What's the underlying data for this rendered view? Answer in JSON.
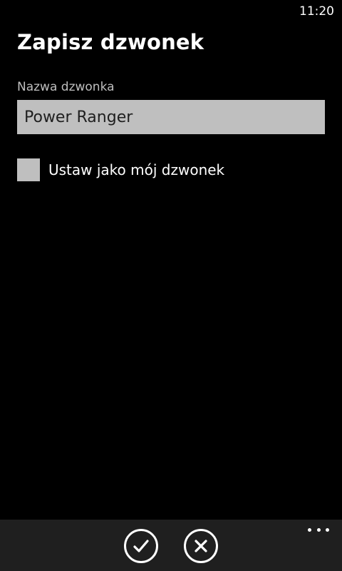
{
  "status_bar": {
    "time": "11:20"
  },
  "page": {
    "title": "Zapisz dzwonek"
  },
  "form": {
    "name_label": "Nazwa dzwonka",
    "name_value": "Power Ranger",
    "set_as_ringtone_label": "Ustaw jako mój dzwonek",
    "set_as_ringtone_checked": false
  },
  "app_bar": {
    "buttons": [
      {
        "icon": "check-icon"
      },
      {
        "icon": "close-icon"
      }
    ],
    "more_icon": "more-options-icon"
  },
  "colors": {
    "background": "#000000",
    "control_fill": "#bfbfbf",
    "app_bar": "#1f1f1f",
    "text": "#ffffff"
  }
}
